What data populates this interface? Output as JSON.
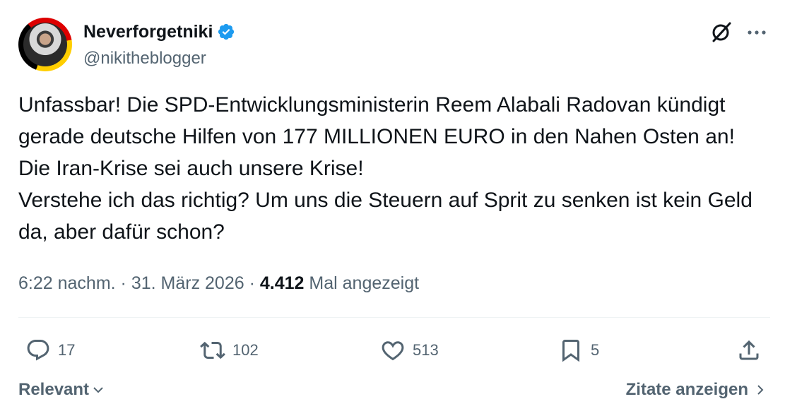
{
  "author": {
    "display_name": "Neverforgetniki",
    "handle": "@nikitheblogger",
    "verified": true,
    "avatar_ring_colors": [
      "#000000",
      "#dd0000",
      "#ffce00"
    ]
  },
  "tweet": {
    "lines": [
      "Unfassbar! Die SPD-Entwicklungsministerin Reem Alabali Radovan kündigt gerade deutsche Hilfen von 177 MILLIONEN EURO in den Nahen Osten an! Die Iran-Krise sei auch unsere Krise!",
      "Verstehe ich das richtig? Um uns die Steuern auf Sprit zu senken ist kein Geld da, aber dafür schon?"
    ]
  },
  "meta": {
    "time": "6:22 nachm.",
    "separator": "·",
    "date": "31. März 2026",
    "views_count": "4.412",
    "views_label": "Mal angezeigt"
  },
  "actions": {
    "reply_count": "17",
    "retweet_count": "102",
    "like_count": "513",
    "bookmark_count": "5"
  },
  "footer": {
    "sort_label": "Relevant",
    "quotes_label": "Zitate anzeigen"
  },
  "colors": {
    "verified": "#1d9bf0",
    "secondary_text": "#536471",
    "primary_text": "#0f1419"
  },
  "icons": [
    "verified-badge-icon",
    "grok-icon",
    "more-icon",
    "reply-icon",
    "retweet-icon",
    "like-icon",
    "bookmark-icon",
    "share-icon",
    "chevron-down-icon",
    "chevron-right-icon"
  ]
}
